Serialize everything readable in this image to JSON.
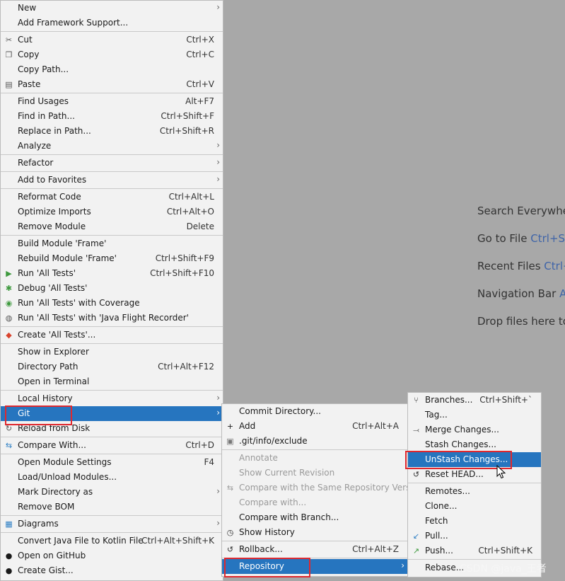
{
  "background_hints": [
    {
      "label": "Search Everywher",
      "key": ""
    },
    {
      "label": "Go to File ",
      "key": "Ctrl+Sh"
    },
    {
      "label": "Recent Files ",
      "key": "Ctrl+I"
    },
    {
      "label": "Navigation Bar ",
      "key": "Alt"
    },
    {
      "label": "Drop files here to",
      "key": ""
    }
  ],
  "main_menu": {
    "items": [
      {
        "label": "New",
        "shortcut": "",
        "submenu": true
      },
      {
        "label": "Add Framework Support...",
        "shortcut": ""
      },
      {
        "label": "Cut",
        "shortcut": "Ctrl+X",
        "icon": "scissors-icon"
      },
      {
        "label": "Copy",
        "shortcut": "Ctrl+C",
        "icon": "copy-icon"
      },
      {
        "label": "Copy Path...",
        "shortcut": ""
      },
      {
        "label": "Paste",
        "shortcut": "Ctrl+V",
        "icon": "clipboard-icon"
      },
      {
        "label": "Find Usages",
        "shortcut": "Alt+F7"
      },
      {
        "label": "Find in Path...",
        "shortcut": "Ctrl+Shift+F"
      },
      {
        "label": "Replace in Path...",
        "shortcut": "Ctrl+Shift+R"
      },
      {
        "label": "Analyze",
        "shortcut": "",
        "submenu": true
      },
      {
        "label": "Refactor",
        "shortcut": "",
        "submenu": true
      },
      {
        "label": "Add to Favorites",
        "shortcut": "",
        "submenu": true
      },
      {
        "label": "Reformat Code",
        "shortcut": "Ctrl+Alt+L"
      },
      {
        "label": "Optimize Imports",
        "shortcut": "Ctrl+Alt+O"
      },
      {
        "label": "Remove Module",
        "shortcut": "Delete"
      },
      {
        "label": "Build Module 'Frame'",
        "shortcut": ""
      },
      {
        "label": "Rebuild Module 'Frame'",
        "shortcut": "Ctrl+Shift+F9"
      },
      {
        "label": "Run 'All Tests'",
        "shortcut": "Ctrl+Shift+F10",
        "icon": "run-icon"
      },
      {
        "label": "Debug 'All Tests'",
        "shortcut": "",
        "icon": "debug-icon"
      },
      {
        "label": "Run 'All Tests' with Coverage",
        "shortcut": "",
        "icon": "coverage-icon"
      },
      {
        "label": "Run 'All Tests' with 'Java Flight Recorder'",
        "shortcut": "",
        "icon": "profiler-icon"
      },
      {
        "label": "Create 'All Tests'...",
        "shortcut": "",
        "icon": "create-test-icon"
      },
      {
        "label": "Show in Explorer",
        "shortcut": ""
      },
      {
        "label": "Directory Path",
        "shortcut": "Ctrl+Alt+F12"
      },
      {
        "label": "Open in Terminal",
        "shortcut": ""
      },
      {
        "label": "Local History",
        "shortcut": "",
        "submenu": true
      },
      {
        "label": "Git",
        "shortcut": "",
        "submenu": true,
        "selected": true
      },
      {
        "label": "Reload from Disk",
        "shortcut": "",
        "icon": "reload-icon"
      },
      {
        "label": "Compare With...",
        "shortcut": "Ctrl+D",
        "icon": "compare-icon"
      },
      {
        "label": "Open Module Settings",
        "shortcut": "F4"
      },
      {
        "label": "Load/Unload Modules...",
        "shortcut": ""
      },
      {
        "label": "Mark Directory as",
        "shortcut": "",
        "submenu": true
      },
      {
        "label": "Remove BOM",
        "shortcut": ""
      },
      {
        "label": "Diagrams",
        "shortcut": "",
        "submenu": true,
        "icon": "diagram-icon"
      },
      {
        "label": "Convert Java File to Kotlin File",
        "shortcut": "Ctrl+Alt+Shift+K"
      },
      {
        "label": "Open on GitHub",
        "shortcut": "",
        "icon": "github-icon"
      },
      {
        "label": "Create Gist...",
        "shortcut": "",
        "icon": "github-icon"
      }
    ]
  },
  "git_menu": {
    "items": [
      {
        "label": "Commit Directory...",
        "shortcut": ""
      },
      {
        "label": "Add",
        "shortcut": "Ctrl+Alt+A",
        "icon": "plus-icon"
      },
      {
        "label": ".git/info/exclude",
        "shortcut": "",
        "icon": "file-icon"
      },
      {
        "label": "Annotate",
        "shortcut": "",
        "disabled": true
      },
      {
        "label": "Show Current Revision",
        "shortcut": "",
        "disabled": true
      },
      {
        "label": "Compare with the Same Repository Version",
        "shortcut": "",
        "disabled": true,
        "icon": "compare-icon"
      },
      {
        "label": "Compare with...",
        "shortcut": "",
        "disabled": true
      },
      {
        "label": "Compare with Branch...",
        "shortcut": ""
      },
      {
        "label": "Show History",
        "shortcut": "",
        "icon": "history-icon"
      },
      {
        "label": "Rollback...",
        "shortcut": "Ctrl+Alt+Z",
        "icon": "rollback-icon"
      },
      {
        "label": "Repository",
        "shortcut": "",
        "submenu": true,
        "selected": true
      }
    ]
  },
  "repo_menu": {
    "items": [
      {
        "label": "Branches...",
        "shortcut": "Ctrl+Shift+`",
        "icon": "branch-icon"
      },
      {
        "label": "Tag...",
        "shortcut": ""
      },
      {
        "label": "Merge Changes...",
        "shortcut": "",
        "icon": "merge-icon"
      },
      {
        "label": "Stash Changes...",
        "shortcut": ""
      },
      {
        "label": "UnStash Changes...",
        "shortcut": "",
        "selected": true
      },
      {
        "label": "Reset HEAD...",
        "shortcut": "",
        "icon": "reset-icon"
      },
      {
        "label": "Remotes...",
        "shortcut": ""
      },
      {
        "label": "Clone...",
        "shortcut": ""
      },
      {
        "label": "Fetch",
        "shortcut": ""
      },
      {
        "label": "Pull...",
        "shortcut": "",
        "icon": "pull-icon"
      },
      {
        "label": "Push...",
        "shortcut": "Ctrl+Shift+K",
        "icon": "push-icon"
      },
      {
        "label": "Rebase...",
        "shortcut": ""
      }
    ]
  },
  "watermark": "CSDN @java_王者",
  "colors": {
    "selection": "#2675bf",
    "highlight_box": "#e0282e",
    "menu_bg": "#f2f2f2",
    "shortcut_key": "#3f64a8"
  }
}
